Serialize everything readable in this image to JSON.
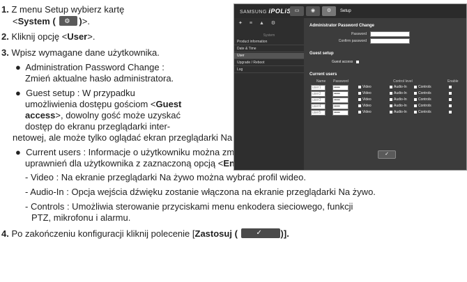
{
  "steps": {
    "s1_num": "1.",
    "s1_a": "Z menu Setup wybierz kartę",
    "s1_b_pre": "<",
    "s1_b_bold": "System (",
    "s1_b_post_bold": ")",
    "s1_b_end": ">.",
    "s2_num": "2.",
    "s2_pre": "Kliknij opcję <",
    "s2_bold": "User",
    "s2_post": ">.",
    "s3_num": "3.",
    "s3_text": "Wpisz wymagane dane użytkownika.",
    "b1_a": "Administration Password Change :",
    "b1_b": "Zmień aktualne hasło administratora.",
    "b2_a_pre": "Guest setup : W przypadku",
    "b2_b_pre": "umożliwienia dostępu gościom <",
    "b2_b_bold": "Guest",
    "b2_c_bold": "access",
    "b2_c_post": ">, dowolny gość może uzyskać",
    "b2_d": "dostęp do ekranu  przeglądarki inter-",
    "b2_e": "netowej, ale może tylko oglądać ekran przeglądarki Na żywo.",
    "b3_a": "Current users : Informacje o użytkowniku można zmienić i ustawić poziom",
    "b3_b_pre": "uprawnień dla użytkownika z zaznaczoną opcją <",
    "b3_b_bold": "Enable",
    "b3_b_post": ">.",
    "d1": "- Video : Na ekranie przeglądarki Na żywo można wybrać profil wideo.",
    "d2": "- Audio-In : Opcja wejścia dźwięku zostanie włączona na ekranie przeglądarki Na żywo.",
    "d3_a": "- Controls : Umożliwia sterowanie przyciskami menu enkodera sieciowego, funkcji",
    "d3_b": "PTZ, mikrofonu i alarmu.",
    "s4_num": "4.",
    "s4_pre": "Po zakończeniu konfiguracji kliknij polecenie [",
    "s4_bold": "Zastosuj (",
    "s4_post": ")]."
  },
  "screenshot": {
    "brand_left": "SAMSUNG",
    "brand_right": "iPOLiS",
    "setup_label": "Setup",
    "sidebar_section": "System",
    "sidebar_items": [
      "Product information",
      "Date & Time",
      "User",
      "Upgrade / Reboot",
      "Log"
    ],
    "sec1_title": "Administrator Password Change",
    "password_label": "Password",
    "confirm_label": "Confirm password",
    "sec2_title": "Guest setup",
    "guest_access_label": "Guest access",
    "sec3_title": "Current users",
    "col_name": "Name",
    "col_password": "Password",
    "col_control": "Control level",
    "col_enable": "Enable",
    "users": [
      {
        "name": "user1",
        "pw": "•••••",
        "video": "Video",
        "audio": "Audio-In",
        "controls": "Controls"
      },
      {
        "name": "user2",
        "pw": "•••••",
        "video": "Video",
        "audio": "Audio-In",
        "controls": "Controls"
      },
      {
        "name": "user3",
        "pw": "•••••",
        "video": "Video",
        "audio": "Audio-In",
        "controls": "Controls"
      },
      {
        "name": "user4",
        "pw": "•••••",
        "video": "Video",
        "audio": "Audio-In",
        "controls": "Controls"
      },
      {
        "name": "user5",
        "pw": "•••••",
        "video": "Video",
        "audio": "Audio-In",
        "controls": "Controls"
      }
    ],
    "apply_glyph": "✓"
  }
}
